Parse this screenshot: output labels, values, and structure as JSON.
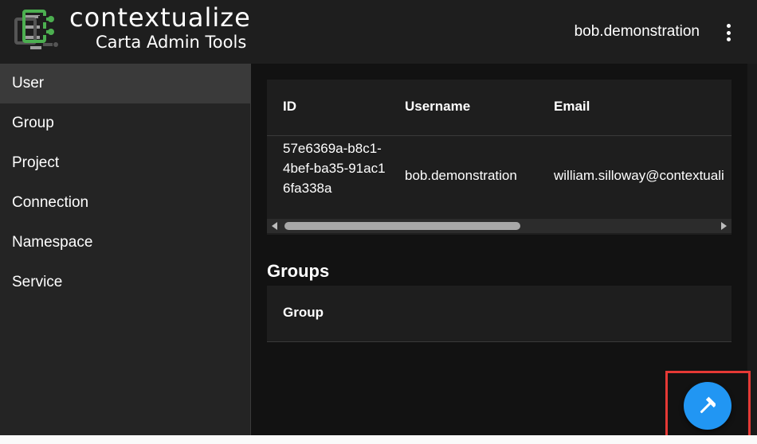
{
  "header": {
    "brand": "contextualize",
    "subtitle": "Carta Admin Tools",
    "username": "bob.demonstration",
    "logo_icon": "contextualize-logo",
    "menu_icon": "more-vert-icon"
  },
  "sidebar": {
    "items": [
      {
        "label": "User",
        "active": true
      },
      {
        "label": "Group",
        "active": false
      },
      {
        "label": "Project",
        "active": false
      },
      {
        "label": "Connection",
        "active": false
      },
      {
        "label": "Namespace",
        "active": false
      },
      {
        "label": "Service",
        "active": false
      }
    ]
  },
  "user_table": {
    "columns": [
      "ID",
      "Username",
      "Email"
    ],
    "rows": [
      {
        "id": "57e6369a-b8c1-4bef-ba35-91ac16fa338a",
        "username": "bob.demonstration",
        "email": "william.silloway@contextuali"
      }
    ]
  },
  "groups": {
    "title": "Groups",
    "columns": [
      "Group"
    ]
  },
  "fab": {
    "icon": "hammer-icon"
  },
  "colors": {
    "accent": "#2196f3",
    "highlight": "#e53935",
    "logo_green": "#4caf50",
    "logo_gray": "#9e9e9e"
  }
}
